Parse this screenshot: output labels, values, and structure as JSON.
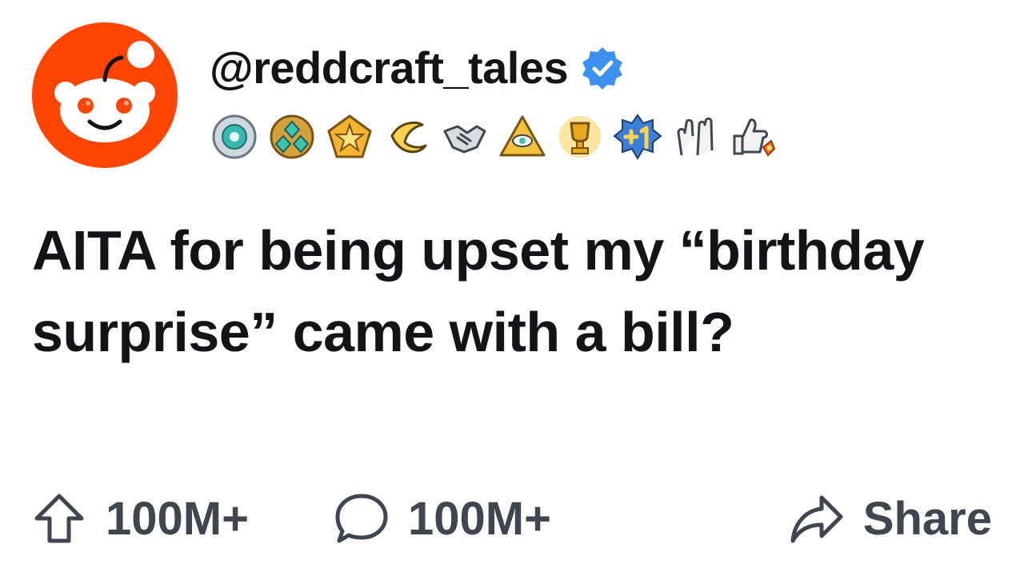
{
  "post": {
    "username": "@reddcraft_tales",
    "verified": true,
    "title": "AITA for being upset my “birthday surprise” came with a bill?"
  },
  "badges": [
    "silver-medal-icon",
    "gem-cluster-icon",
    "star-pentagon-icon",
    "banana-icon",
    "handshake-icon",
    "eye-pyramid-icon",
    "gold-trophy-icon",
    "plus-one-icon",
    "clapping-hands-icon",
    "thumbs-up-rocket-icon"
  ],
  "actions": {
    "upvote_count": "100M+",
    "comment_count": "100M+",
    "share_label": "Share"
  },
  "colors": {
    "brand": "#ff4500",
    "verified": "#3d8ff0",
    "text": "#121418",
    "muted": "#3f4650"
  }
}
